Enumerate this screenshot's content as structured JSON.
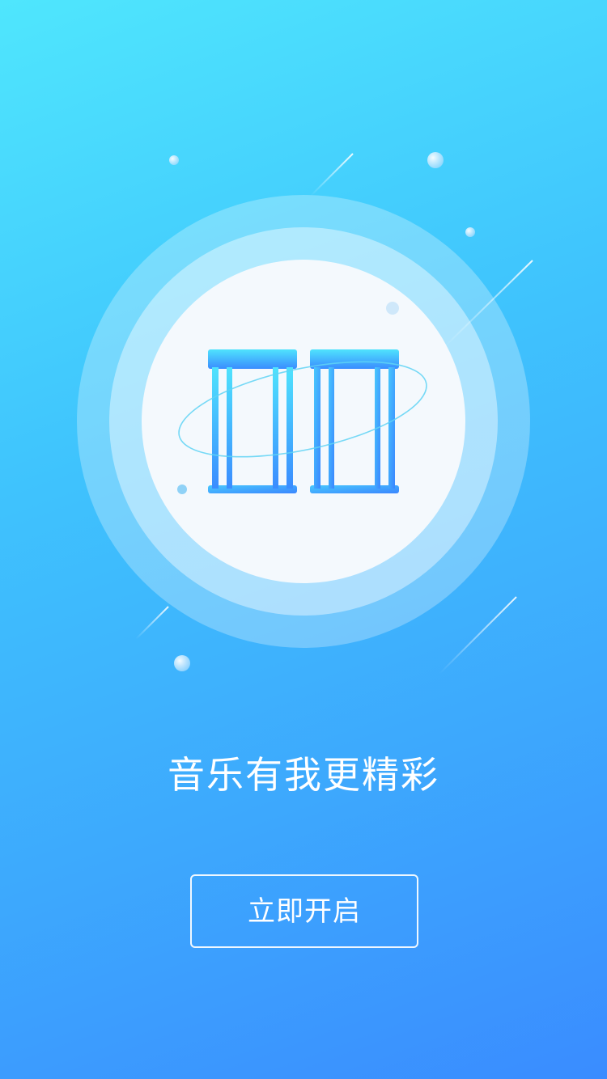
{
  "slogan": "音乐有我更精彩",
  "start_button": {
    "label": "立即开启"
  },
  "illustration": {
    "icon": "speaker-columns-icon",
    "colors": {
      "icon_top": "#4fe3fd",
      "icon_bottom": "#3a8cff",
      "outer_ring": "#7fd0fd",
      "middle_ring": "#bfe6fd",
      "inner_disc": "#f4f9fd"
    }
  }
}
